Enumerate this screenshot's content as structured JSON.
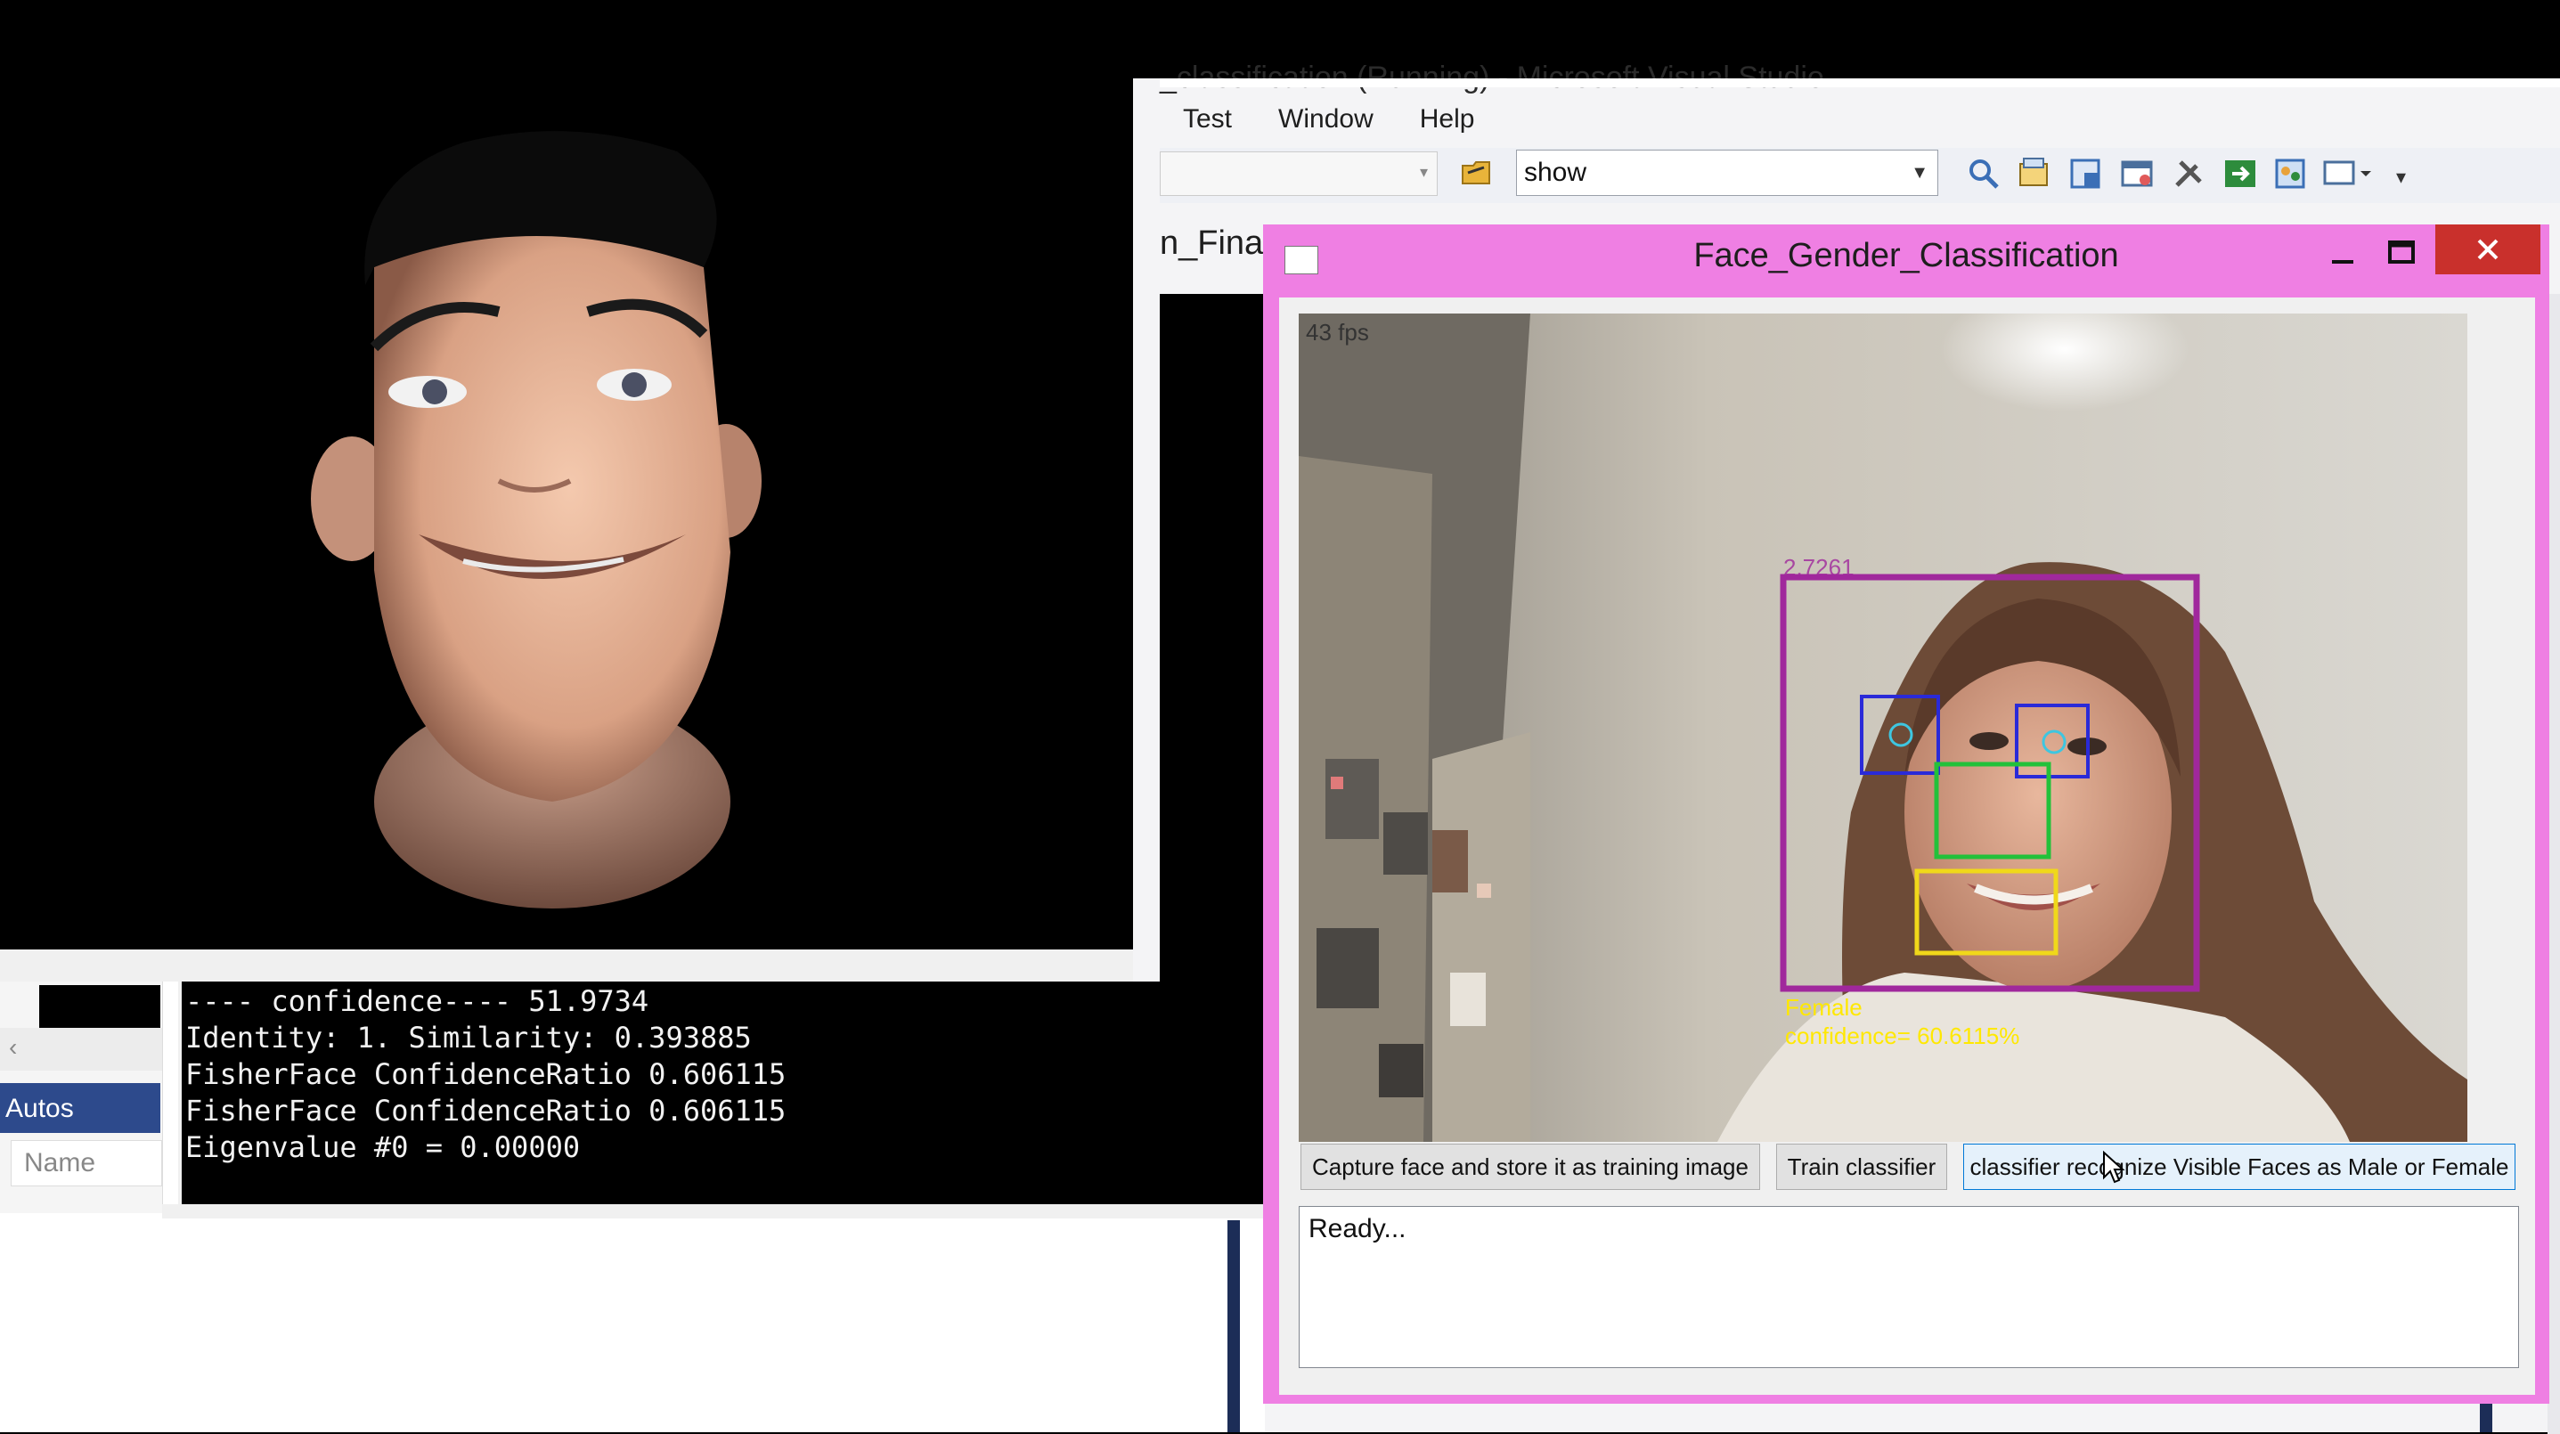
{
  "vs": {
    "title": "_classification (Running) - Microsoft Visual Studio",
    "menu": [
      "Test",
      "Window",
      "Help"
    ],
    "config_combo_value": "show",
    "doc_tab": "n_Final"
  },
  "autos": {
    "tab_label": "Autos",
    "column_name": "Name"
  },
  "console": {
    "lines": [
      "---- confidence---- 51.9734",
      "Identity: 1. Similarity: 0.393885",
      "FisherFace ConfidenceRatio 0.606115",
      "FisherFace ConfidenceRatio 0.606115",
      "Eigenvalue #0 = 0.00000"
    ]
  },
  "face_app": {
    "title": "Face_Gender_Classification",
    "fps": "43 fps",
    "detection": {
      "partial_value": "2.7261",
      "gender": "Female",
      "confidence": "confidence= 60.6115%"
    },
    "buttons": {
      "capture": "Capture face and store it as training image",
      "train": "Train classifier",
      "classify": "classifier recognize Visible Faces as Male or Female"
    },
    "status": "Ready..."
  },
  "colors": {
    "face_window_border": "#ef7fe3",
    "close_button": "#c9302c",
    "face_box": "#a0289c",
    "eye_box": "#2a2ad8",
    "nose_box": "#22c13a",
    "mouth_box": "#f0d81a",
    "label_text": "#ffe800",
    "autos_tab": "#2d4a8c"
  },
  "icons": [
    "folder-open-icon",
    "find-icon",
    "properties-icon",
    "toolbox-icon",
    "tools-icon",
    "start-icon",
    "window-icon"
  ]
}
